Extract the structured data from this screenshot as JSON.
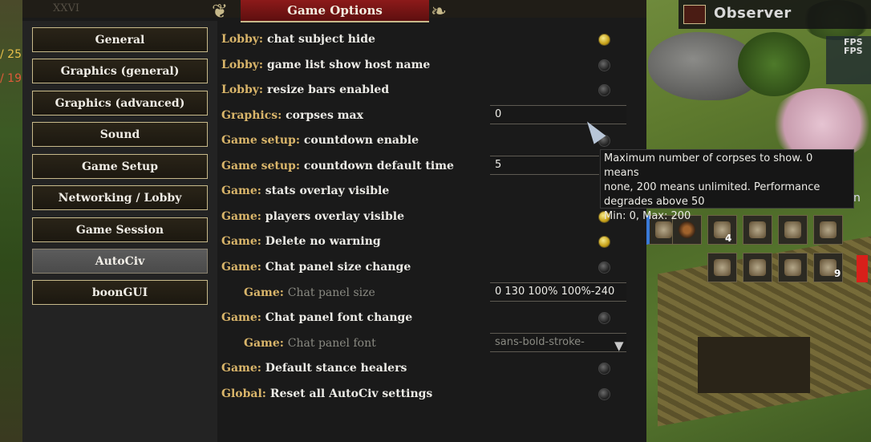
{
  "window": {
    "title": "Game Options",
    "faded_header": "XXVI"
  },
  "observer": {
    "label": "Observer"
  },
  "fps": {
    "label": "FPS",
    "label2": "FPS"
  },
  "left_hud": {
    "num1": "/ 25",
    "num2": "/ 19"
  },
  "side_hud": {
    "letter": "n"
  },
  "badges": {
    "b1": "4",
    "b2": "9"
  },
  "sidebar": {
    "items": [
      {
        "label": "General"
      },
      {
        "label": "Graphics (general)"
      },
      {
        "label": "Graphics (advanced)"
      },
      {
        "label": "Sound"
      },
      {
        "label": "Game Setup"
      },
      {
        "label": "Networking / Lobby"
      },
      {
        "label": "Game Session"
      },
      {
        "label": "AutoCiv"
      },
      {
        "label": "boonGUI"
      }
    ],
    "active": "AutoCiv"
  },
  "options": [
    {
      "cat": "Lobby:",
      "label": "chat subject hide",
      "type": "checkbox",
      "checked": true
    },
    {
      "cat": "Lobby:",
      "label": "game list show host name",
      "type": "checkbox",
      "checked": false
    },
    {
      "cat": "Lobby:",
      "label": "resize bars enabled",
      "type": "checkbox",
      "checked": false
    },
    {
      "cat": "Graphics:",
      "label": "corpses max",
      "type": "number",
      "value": "0"
    },
    {
      "cat": "Game setup:",
      "label": "countdown enable",
      "type": "checkbox",
      "checked": false
    },
    {
      "cat": "Game setup:",
      "label": "countdown default time",
      "type": "number",
      "value": "5"
    },
    {
      "cat": "Game:",
      "label": "stats overlay visible",
      "type": "checkbox",
      "checked": false
    },
    {
      "cat": "Game:",
      "label": "players overlay visible",
      "type": "checkbox",
      "checked": true
    },
    {
      "cat": "Game:",
      "label": "Delete no warning",
      "type": "checkbox",
      "checked": true
    },
    {
      "cat": "Game:",
      "label": "Chat panel size change",
      "type": "checkbox",
      "checked": false
    },
    {
      "cat": "Game:",
      "label": "Chat panel size",
      "type": "string",
      "value": "0 130 100% 100%-240",
      "sub": true
    },
    {
      "cat": "Game:",
      "label": "Chat panel font change",
      "type": "checkbox",
      "checked": false
    },
    {
      "cat": "Game:",
      "label": "Chat panel font",
      "type": "dropdown",
      "value": "sans-bold-stroke-",
      "sub": true
    },
    {
      "cat": "Game:",
      "label": "Default stance healers",
      "type": "checkbox",
      "checked": false
    },
    {
      "cat": "Global:",
      "label": "Reset all AutoCiv settings",
      "type": "checkbox",
      "checked": false
    }
  ],
  "tooltip": {
    "line1": "Maximum number of corpses to show. 0 means",
    "line2": "none, 200 means unlimited. Performance",
    "line3": "degrades above 50",
    "line4": "Min: 0, Max: 200"
  },
  "colors": {
    "accent_category": "#d9b56a",
    "title_bar": "#8c1a1a",
    "border": "#c7b98a",
    "radio_on": "#e8d04a"
  },
  "icons": {
    "radio_on": "radio-checked-icon",
    "radio_off": "radio-unchecked-icon",
    "dropdown": "chevron-down-icon",
    "ornament": "scroll-ornament-icon",
    "cursor": "mouse-cursor-icon"
  }
}
